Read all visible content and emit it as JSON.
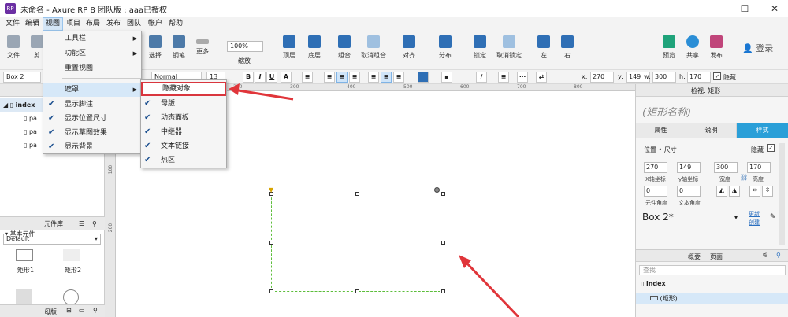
{
  "title": "未命名 - Axure RP 8 团队版 : aaa已授权",
  "window_controls": {
    "minimize": "—",
    "maximize": "☐",
    "close": "✕"
  },
  "menu": [
    "文件",
    "编辑",
    "视图",
    "项目",
    "布局",
    "发布",
    "团队",
    "帐户",
    "帮助"
  ],
  "toolbar": {
    "file": "文件",
    "clip": "剪",
    "select": "选择",
    "connect": "钢笔",
    "more": "更多",
    "zoom_value": "100%",
    "zoom_label": "缩放",
    "top": "顶层",
    "bottom": "底层",
    "group": "组合",
    "ungroup": "取消组合",
    "align": "对齐",
    "distribute": "分布",
    "lock": "锁定",
    "unlock": "取消锁定",
    "left": "左",
    "right": "右",
    "preview": "预览",
    "share": "共享",
    "publish": "发布",
    "login": "登录"
  },
  "format": {
    "name_field": "Box 2",
    "font_style": "Normal",
    "font_size": "13",
    "x_label": "x:",
    "x": "270",
    "y_label": "y:",
    "y": "149",
    "w_label": "w:",
    "w": "300",
    "h_label": "h:",
    "h": "170",
    "hidden_label": "隐藏"
  },
  "view_menu": [
    {
      "label": "工具栏",
      "checked": false,
      "submenu": true
    },
    {
      "label": "功能区",
      "checked": false,
      "submenu": true
    },
    {
      "label": "重置视图",
      "checked": false,
      "submenu": false
    },
    {
      "label": "遮罩",
      "checked": false,
      "submenu": true
    },
    {
      "label": "显示脚注",
      "checked": true,
      "submenu": false
    },
    {
      "label": "显示位置尺寸",
      "checked": true,
      "submenu": false
    },
    {
      "label": "显示草图效果",
      "checked": true,
      "submenu": false
    },
    {
      "label": "显示背景",
      "checked": true,
      "submenu": false
    }
  ],
  "mask_submenu": [
    "隐藏对象",
    "母版",
    "动态面板",
    "中继器",
    "文本链接",
    "热区"
  ],
  "pages": {
    "root": "index",
    "children": [
      "pa",
      "pa",
      "pa"
    ]
  },
  "library": {
    "header": "元件库",
    "select": "Default",
    "group": "基本元件",
    "items": [
      "矩形1",
      "矩形2"
    ],
    "footer": "母版"
  },
  "ruler": {
    "h": [
      "100",
      "200",
      "300",
      "400",
      "500",
      "600",
      "700",
      "800"
    ],
    "v": [
      "100",
      "200"
    ]
  },
  "inspector": {
    "header_a": "检视: 矩形",
    "shape_name_placeholder": "(矩形名称)",
    "tabs": [
      "属性",
      "说明",
      "样式"
    ],
    "section": "位置 • 尺寸",
    "hidden": "隐藏",
    "x": "270",
    "y": "149",
    "w": "300",
    "h": "170",
    "x_lbl": "X轴坐标",
    "y_lbl": "y轴坐标",
    "w_lbl": "宽度",
    "h_lbl": "高度",
    "rot": "0",
    "text_rot": "0",
    "rot_lbl": "元件角度",
    "text_rot_lbl": "文本角度",
    "style_name": "Box 2*",
    "update": "更新",
    "create": "创建"
  },
  "outline": {
    "tabs": [
      "概要",
      "页面"
    ],
    "search_placeholder": "查找",
    "page": "index",
    "item": "(矩形)"
  }
}
